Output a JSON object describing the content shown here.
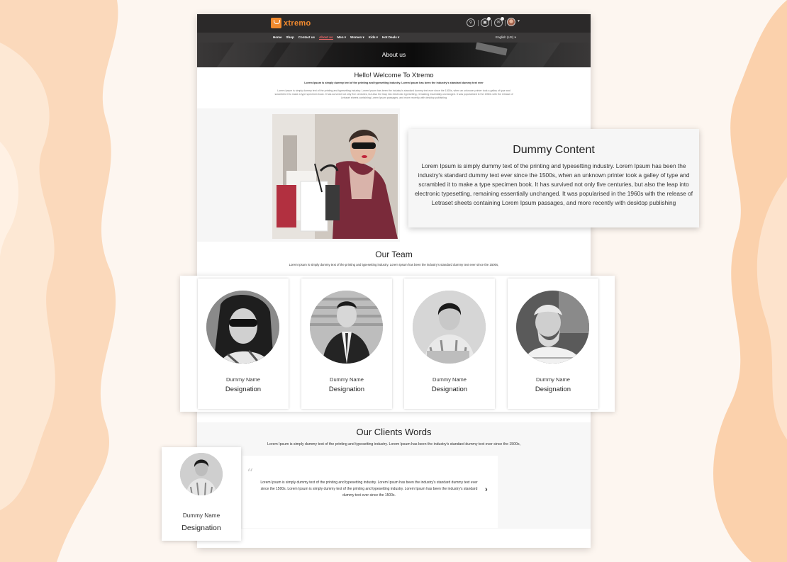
{
  "header": {
    "brand": "xtremo",
    "nav": [
      "Home",
      "Shop",
      "Contact us",
      "About us",
      "Men ▾",
      "Women ▾",
      "Kids ▾",
      "Hot Deals ▾"
    ],
    "active_nav": "About us",
    "language": "English (US) ▾",
    "icons": [
      "search-icon",
      "cart-icon",
      "notification-icon",
      "user-avatar"
    ]
  },
  "hero": {
    "title": "About us"
  },
  "welcome": {
    "title": "Hello! Welcome To Xtremo",
    "subtitle": "Lorem Ipsum is simply dummy text of the printing and typesetting industry. Lorem Ipsum has been the industry's standard dummy text ever",
    "body": "Lorem Ipsum is simply dummy text of the printing and typesetting industry. Lorem Ipsum has been the industry's standard dummy text ever since the 1500s, when an unknown printer took a galley of type and scrambled it to make a type specimen book. It has survived not only five centuries, but also the leap into electronic typesetting, remaining essentially unchanged. It was popularised in the 1960s with the release of Letraset sheets containing Lorem Ipsum passages, and more recently with desktop publishing"
  },
  "feature": {
    "title": "Dummy Content",
    "text": "Lorem Ipsum is simply dummy text of the printing and typesetting industry. Lorem Ipsum has been the industry's standard dummy text ever since the 1500s, when an unknown printer took a galley of type and scrambled it to make a type specimen book. It has survived not only five centuries, but also the leap into electronic typesetting, remaining essentially unchanged. It was popularised in the 1960s with the release of Letraset sheets containing Lorem Ipsum passages, and more recently with desktop publishing"
  },
  "team": {
    "title": "Our Team",
    "subtitle": "Lorem Ipsum is simply dummy text of the printing and typesetting industry. Lorem Ipsum has been the industry's standard dummy text ever since the 1500s,",
    "members": [
      {
        "name": "Dummy Name",
        "designation": "Designation"
      },
      {
        "name": "Dummy Name",
        "designation": "Designation"
      },
      {
        "name": "Dummy Name",
        "designation": "Designation"
      },
      {
        "name": "Dummy Name",
        "designation": "Designation"
      }
    ]
  },
  "clients": {
    "title": "Our Clients Words",
    "subtitle": "Lorem Ipsum is simply dummy text of the printing and typesetting industry. Lorem Ipsum has been the industry's standard dummy text ever since the 1500s,",
    "quote": "Lorem Ipsum is simply dummy text of the printing and typesetting industry. Lorem Ipsum has been the industry's standard dummy text ever since the 1500s. Lorem Ipsum is simply dummy text of the printing and typesetting industry. Lorem Ipsum has been the industry's standard dummy text ever since the 1500s.",
    "client": {
      "name": "Dummy Name",
      "designation": "Designation"
    }
  },
  "colors": {
    "brand": "#f28a2e",
    "active_nav": "#f36a6a",
    "background": "#fdf6f0",
    "blob": "#f9c9a0"
  }
}
